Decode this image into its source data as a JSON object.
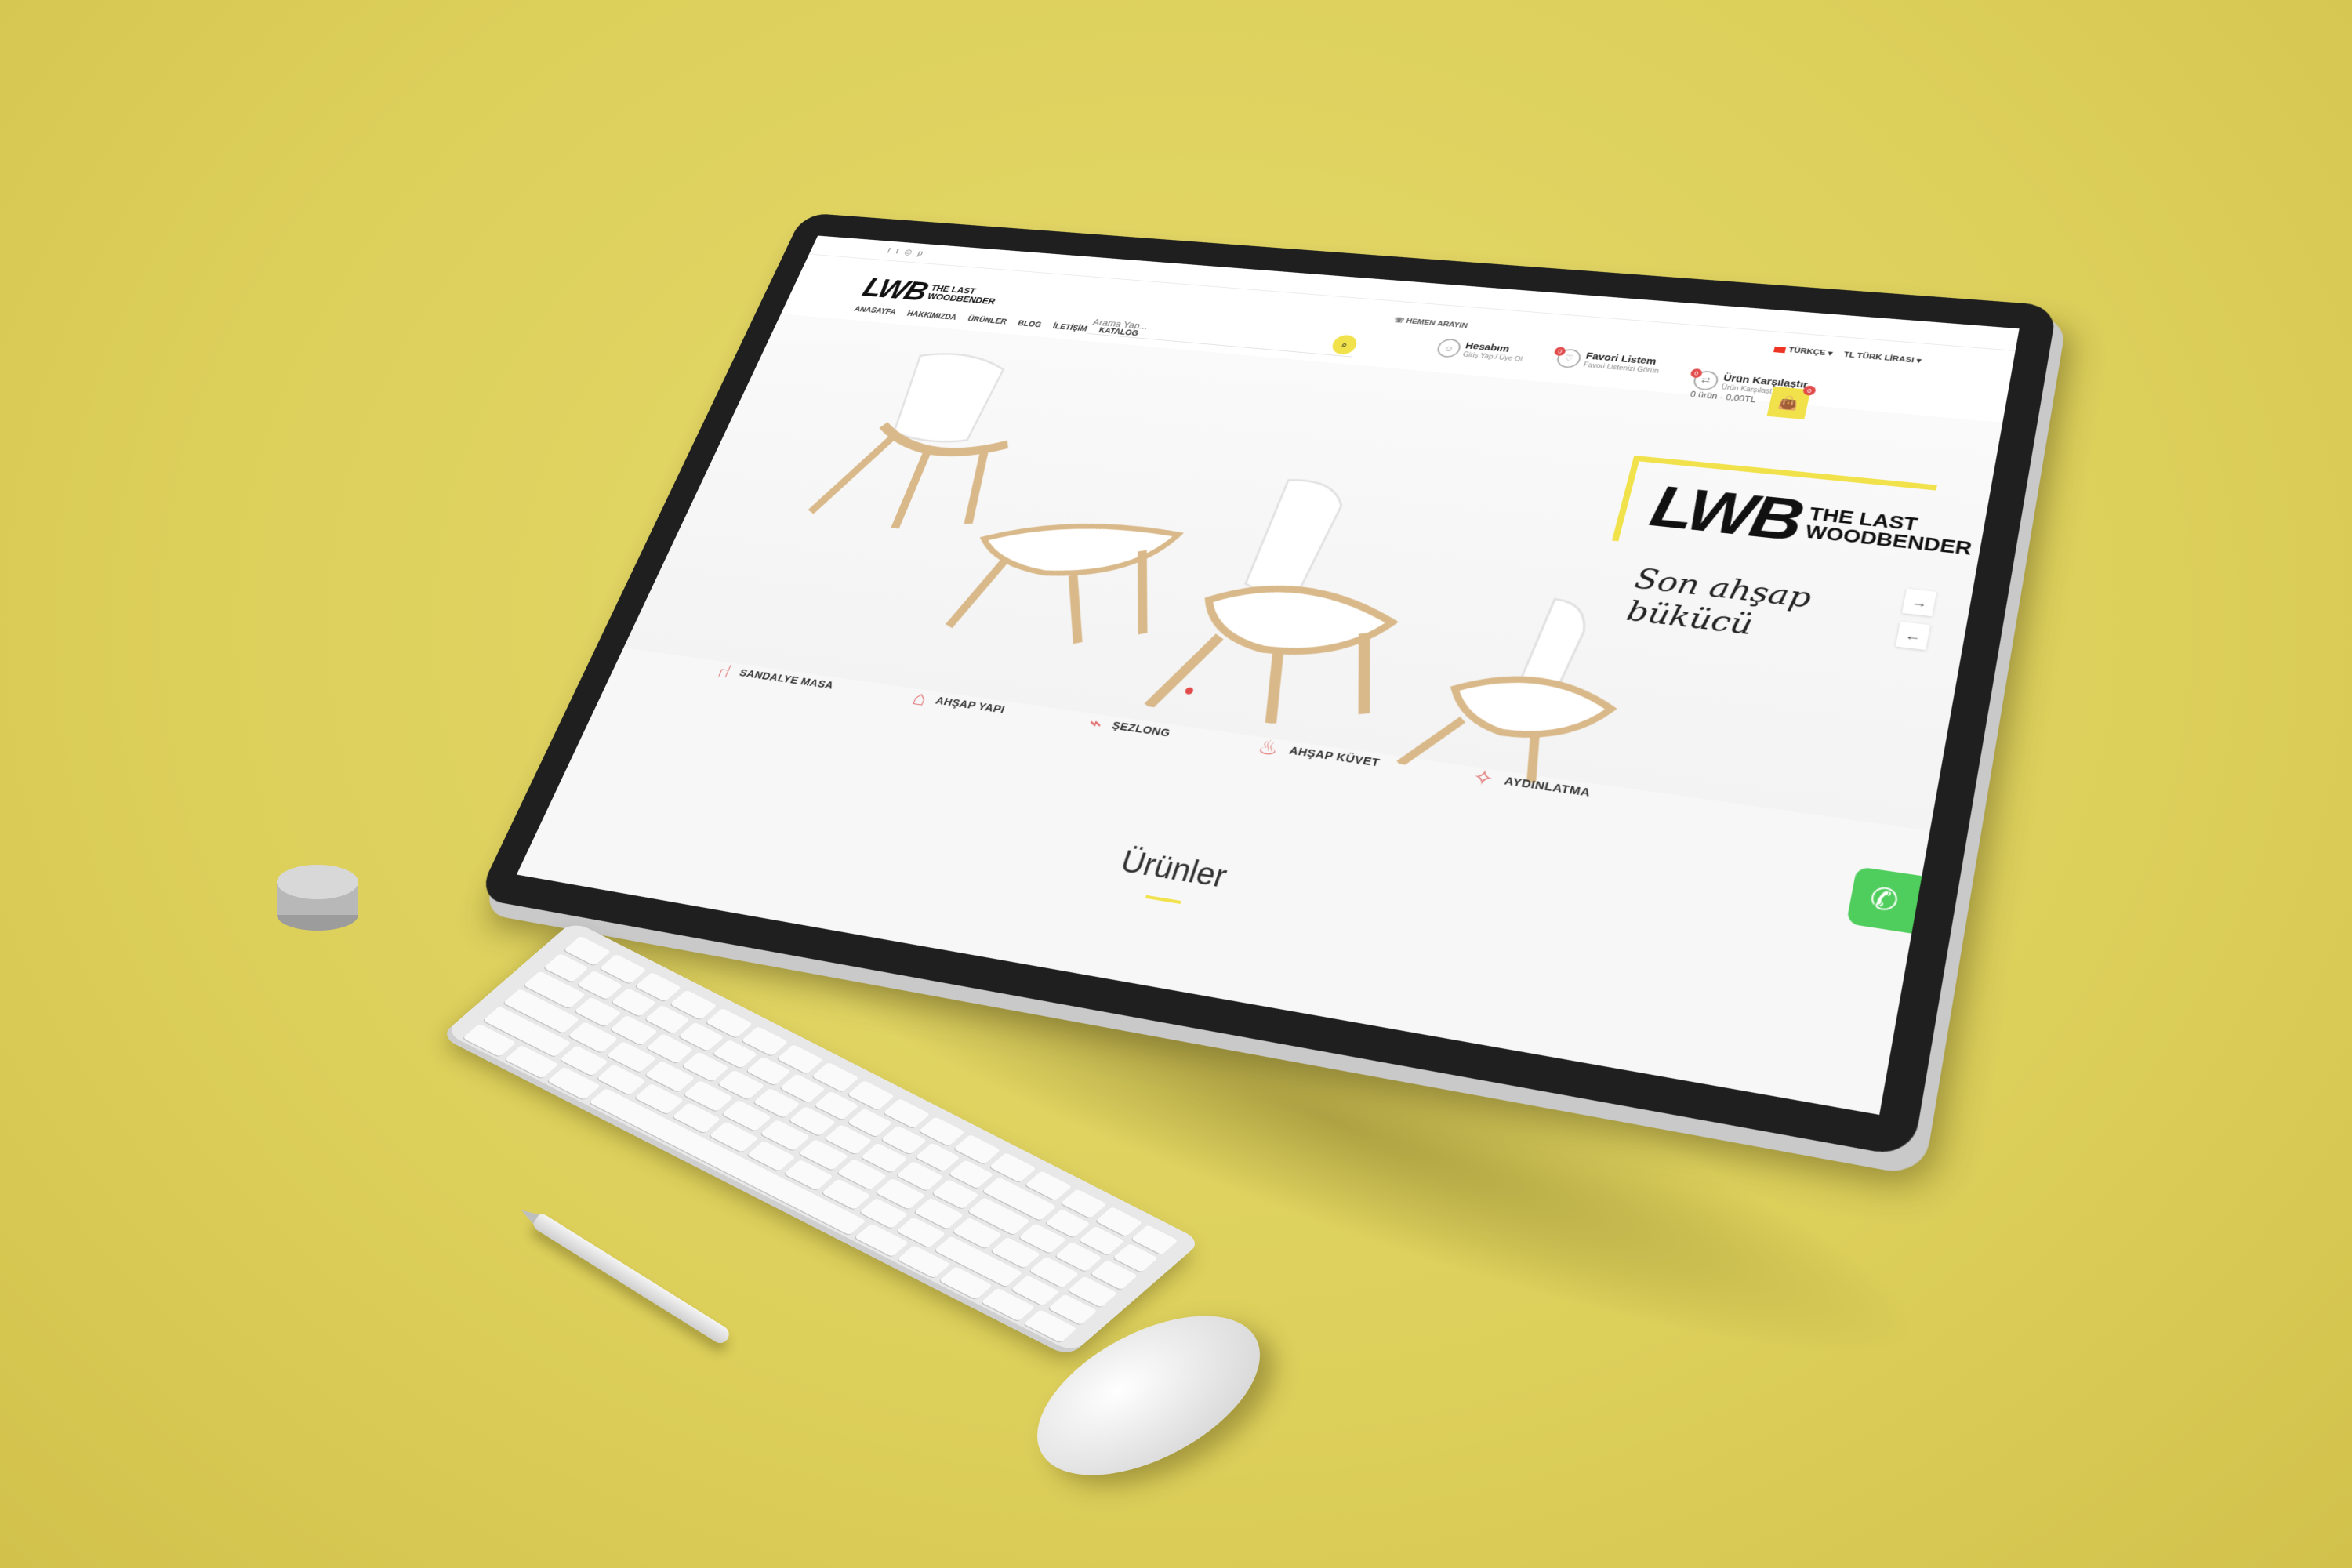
{
  "header": {
    "social_icons": [
      "facebook-icon",
      "twitter-icon",
      "instagram-icon",
      "pinterest-icon"
    ],
    "logo_mark": "LWB",
    "logo_line1": "THE LAST",
    "logo_line2": "WOODBENDER",
    "nav": [
      "ANASAYFA",
      "HAKKIMIZDA",
      "ÜRÜNLER",
      "BLOG",
      "İLETİŞİM",
      "KATALOG"
    ],
    "search_placeholder": "Arama Yap...",
    "call": "HEMEN ARAYIN",
    "language": "TÜRKÇE",
    "currency": "TL TÜRK LİRASI",
    "account": {
      "title": "Hesabım",
      "subtitle": "Giriş Yap / Üye Ol"
    },
    "favorites": {
      "title": "Favori Listem",
      "subtitle": "Favori Listenizi Görün",
      "count": "0"
    },
    "compare": {
      "title": "Ürün Karşılaştır",
      "subtitle": "Ürün Karşılaştırması",
      "count": "0"
    },
    "cart_text": "0 ürün - 0,00TL",
    "cart_count": "0"
  },
  "hero": {
    "brand_mark": "LWB",
    "brand_line1": "THE LAST",
    "brand_line2": "WOODBENDER",
    "slogan": "Son ahşap bükücü",
    "next_arrow": "→",
    "prev_arrow": "←"
  },
  "categories": [
    {
      "label": "SANDALYE MASA",
      "icon": "chair-icon"
    },
    {
      "label": "AHŞAP YAPI",
      "icon": "house-icon"
    },
    {
      "label": "ŞEZLONG",
      "icon": "lounger-icon"
    },
    {
      "label": "AHŞAP KÜVET",
      "icon": "bathtub-icon"
    },
    {
      "label": "AYDINLATMA",
      "icon": "lamp-icon"
    }
  ],
  "products_title": "Ürünler",
  "colors": {
    "accent": "#f1e24b",
    "badge": "#e24b4b",
    "whatsapp": "#4fce5d",
    "background": "#dccf5a"
  }
}
